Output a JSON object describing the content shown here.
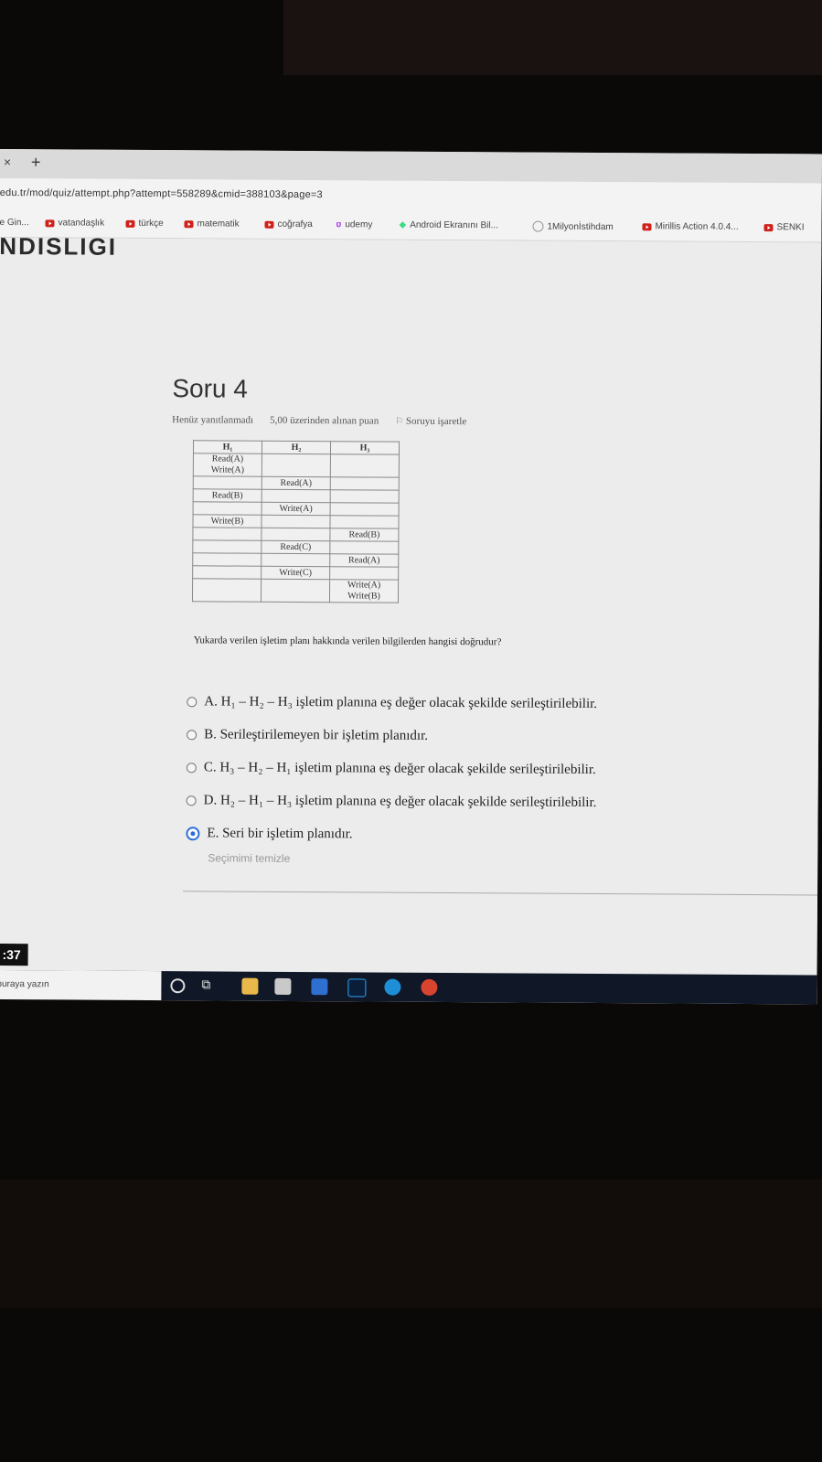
{
  "browser": {
    "tab_close": "×",
    "tab_new": "+",
    "url": "edu.tr/mod/quiz/attempt.php?attempt=558289&cmid=388103&page=3",
    "bookmarks": [
      {
        "label": "e Gin...",
        "icon": "none"
      },
      {
        "label": "vatandaşlık",
        "icon": "youtube-icon"
      },
      {
        "label": "türkçe",
        "icon": "youtube-icon"
      },
      {
        "label": "matematik",
        "icon": "youtube-icon"
      },
      {
        "label": "coğrafya",
        "icon": "youtube-icon"
      },
      {
        "label": "udemy",
        "icon": "udemy-icon"
      },
      {
        "label": "Android Ekranını Bil...",
        "icon": "android-icon"
      },
      {
        "label": "1Milyonİstihdam",
        "icon": "circle-icon"
      },
      {
        "label": "Mirillis Action 4.0.4...",
        "icon": "youtube-icon"
      },
      {
        "label": "SENKI",
        "icon": "youtube-icon"
      }
    ]
  },
  "page": {
    "banner": "NDISLIGI",
    "question_title": "Soru 4",
    "status": "Henüz yanıtlanmadı",
    "points": "5,00 üzerinden alınan puan",
    "flag_label": "Soruyu işaretle",
    "table": {
      "headers": [
        "H₁",
        "H₂",
        "H₃"
      ],
      "rows": [
        [
          "Read(A)\nWrite(A)",
          "",
          ""
        ],
        [
          "",
          "Read(A)",
          ""
        ],
        [
          "Read(B)",
          "",
          ""
        ],
        [
          "",
          "Write(A)",
          ""
        ],
        [
          "Write(B)",
          "",
          ""
        ],
        [
          "",
          "",
          "Read(B)"
        ],
        [
          "",
          "Read(C)",
          ""
        ],
        [
          "",
          "",
          "Read(A)"
        ],
        [
          "",
          "Write(C)",
          ""
        ],
        [
          "",
          "",
          "Write(A)\nWrite(B)"
        ]
      ]
    },
    "question_text": "Yukarda verilen işletim planı hakkında verilen bilgilerden hangisi doğrudur?",
    "options": [
      {
        "label": "A. H₁ – H₂ – H₃ işletim planına eş değer olacak şekilde serileştirilebilir.",
        "selected": false
      },
      {
        "label": "B. Serileştirilemeyen bir işletim planıdır.",
        "selected": false
      },
      {
        "label": "C. H₃ – H₂ – H₁ işletim planına eş değer olacak şekilde serileştirilebilir.",
        "selected": false
      },
      {
        "label": "D. H₂ – H₁ – H₃ işletim planına eş değer olacak şekilde serileştirilebilir.",
        "selected": false
      },
      {
        "label": "E. Seri bir işletim planıdır.",
        "selected": true
      }
    ],
    "clear_choice": "Seçimimi temizle"
  },
  "taskbar": {
    "clock": ":37",
    "search_placeholder": "buraya yazın",
    "apps": [
      "file-explorer-icon",
      "store-icon",
      "mail-icon",
      "photoshop-icon",
      "edge-icon",
      "chrome-icon"
    ]
  },
  "colors": {
    "radio_selected": "#2b6fd6",
    "youtube": "#d0201a",
    "taskbar": "#101828"
  }
}
